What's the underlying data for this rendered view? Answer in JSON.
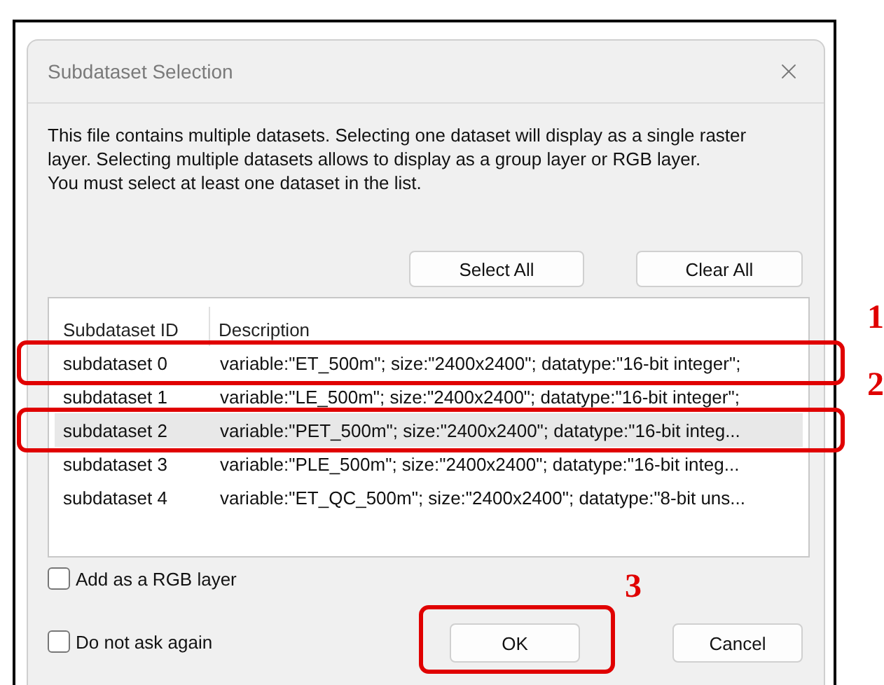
{
  "window": {
    "title": "Subdataset Selection"
  },
  "message": "This file contains multiple datasets. Selecting one dataset will display as a single raster layer. Selecting multiple datasets allows to display as a group layer or RGB layer.\nYou must select at least one dataset in the list.",
  "list_buttons": [
    "Select All",
    "Clear All"
  ],
  "table": {
    "columns": [
      "Subdataset ID",
      "Description"
    ],
    "rows": [
      {
        "id": "subdataset 0",
        "description": "variable:\"ET_500m\"; size:\"2400x2400\"; datatype:\"16-bit integer\";",
        "selected": false,
        "callout": "1"
      },
      {
        "id": "subdataset 1",
        "description": "variable:\"LE_500m\"; size:\"2400x2400\"; datatype:\"16-bit integer\";",
        "selected": false
      },
      {
        "id": "subdataset 2",
        "description": "variable:\"PET_500m\"; size:\"2400x2400\"; datatype:\"16-bit integ...",
        "selected": true,
        "callout": "2"
      },
      {
        "id": "subdataset 3",
        "description": "variable:\"PLE_500m\"; size:\"2400x2400\"; datatype:\"16-bit integ...",
        "selected": false
      },
      {
        "id": "subdataset 4",
        "description": "variable:\"ET_QC_500m\"; size:\"2400x2400\"; datatype:\"8-bit uns...",
        "selected": false
      }
    ]
  },
  "options": [
    {
      "label": "Add as a RGB layer",
      "checked": false
    },
    {
      "label": "Do not ask again",
      "checked": false
    }
  ],
  "dialog_buttons": [
    {
      "label": "OK",
      "callout": "3"
    },
    {
      "label": "Cancel"
    }
  ]
}
